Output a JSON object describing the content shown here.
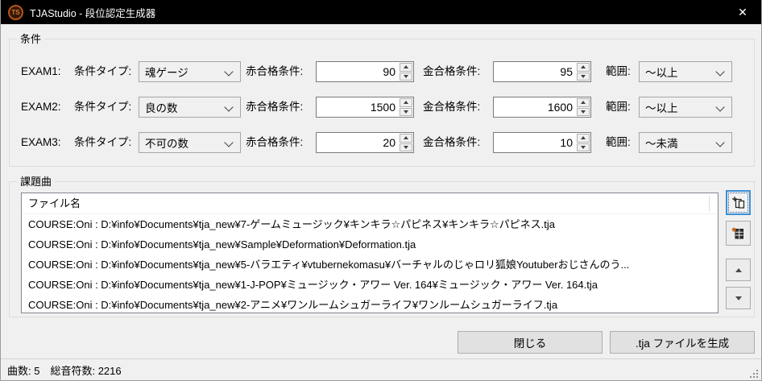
{
  "window": {
    "title": "TJAStudio - 段位認定生成器",
    "app_badge": "TS",
    "close_glyph": "✕"
  },
  "colors": {
    "titlebar_bg": "#000000",
    "client_bg": "#f0f0f0",
    "focus_accent": "#3d8fd6",
    "app_icon_orange": "#b65417",
    "list_border": "#828790",
    "remove_icon_accent": "#c96a1b"
  },
  "icons": {
    "add": "add-files-icon",
    "remove": "remove-song-icon",
    "up": "move-up-icon",
    "down": "move-down-icon"
  },
  "conditions": {
    "group_label": "条件",
    "exams": [
      {
        "exam_label": "EXAM1:",
        "type_label": "条件タイプ:",
        "type_value": "魂ゲージ",
        "red_label": "赤合格条件:",
        "red_value": "90",
        "gold_label": "金合格条件:",
        "gold_value": "95",
        "range_label": "範囲:",
        "range_value": "～以上"
      },
      {
        "exam_label": "EXAM2:",
        "type_label": "条件タイプ:",
        "type_value": "良の数",
        "red_label": "赤合格条件:",
        "red_value": "1500",
        "gold_label": "金合格条件:",
        "gold_value": "1600",
        "range_label": "範囲:",
        "range_value": "～以上"
      },
      {
        "exam_label": "EXAM3:",
        "type_label": "条件タイプ:",
        "type_value": "不可の数",
        "red_label": "赤合格条件:",
        "red_value": "20",
        "gold_label": "金合格条件:",
        "gold_value": "10",
        "range_label": "範囲:",
        "range_value": "～未満"
      }
    ]
  },
  "songs": {
    "group_label": "課題曲",
    "column_header": "ファイル名",
    "rows": [
      "COURSE:Oni : D:¥info¥Documents¥tja_new¥7-ゲームミュージック¥キンキラ☆パピネス¥キンキラ☆パピネス.tja",
      "COURSE:Oni : D:¥info¥Documents¥tja_new¥Sample¥Deformation¥Deformation.tja",
      "COURSE:Oni : D:¥info¥Documents¥tja_new¥5-バラエティ¥vtubernekomasu¥バーチャルのじゃロリ狐娘Youtuberおじさんのう...",
      "COURSE:Oni : D:¥info¥Documents¥tja_new¥1-J-POP¥ミュージック・アワー Ver. 164¥ミュージック・アワー Ver. 164.tja",
      "COURSE:Oni : D:¥info¥Documents¥tja_new¥2-アニメ¥ワンルームシュガーライフ¥ワンルームシュガーライフ.tja"
    ]
  },
  "footer": {
    "close_label": "閉じる",
    "generate_label": ".tja ファイルを生成"
  },
  "statusbar": {
    "song_count": "曲数: 5",
    "note_count": "総音符数: 2216"
  }
}
